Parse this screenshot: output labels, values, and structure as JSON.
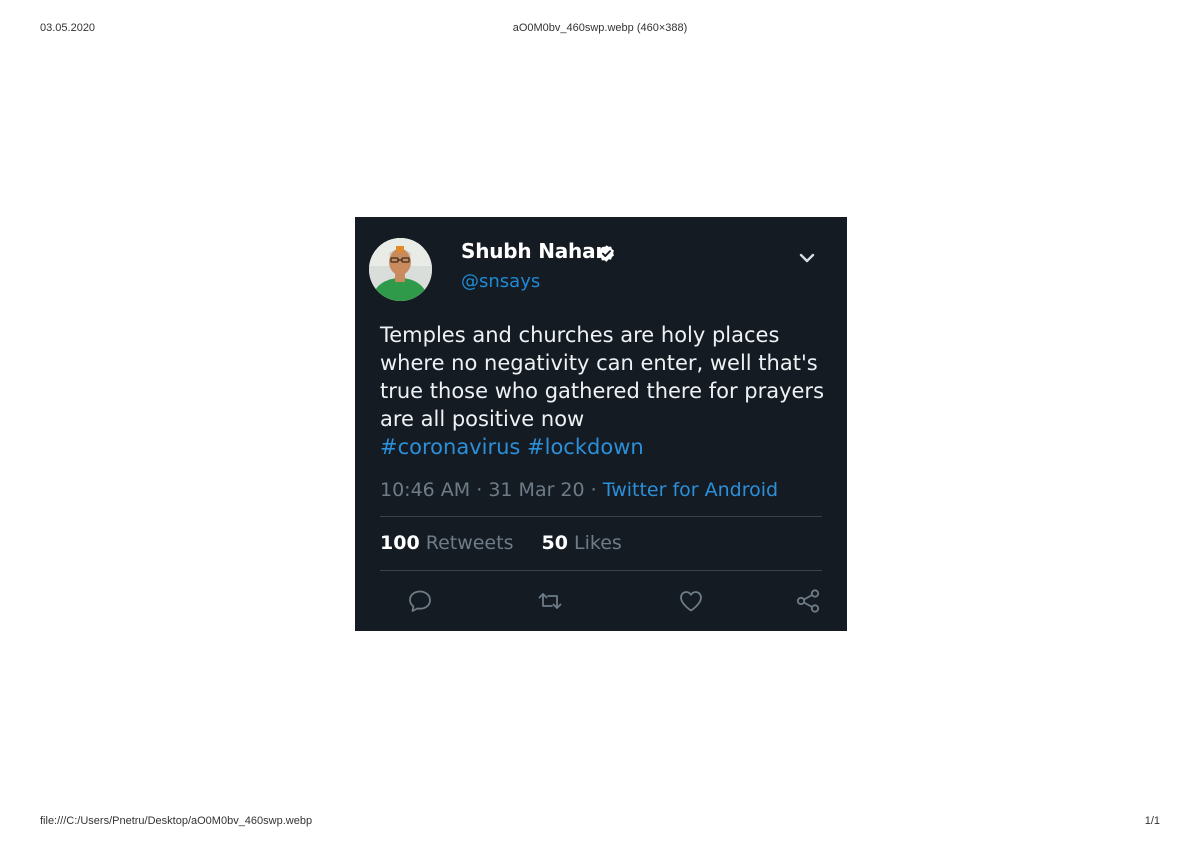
{
  "print_header": {
    "date": "03.05.2020",
    "title": "aO0M0bv_460swp.webp (460×388)"
  },
  "print_footer": {
    "path": "file:///C:/Users/Pnetru/Desktop/aO0M0bv_460swp.webp",
    "page": "1/1"
  },
  "tweet": {
    "display_name": "Shubh Nahar",
    "handle": "@snsays",
    "verified": true,
    "text_lines": [
      "Temples and churches are holy places",
      "where no negativity can enter, well that's",
      "true those who gathered there for prayers",
      "are all positive now"
    ],
    "hashtags": [
      "#coronavirus",
      "#lockdown"
    ],
    "time": "10:46 AM",
    "date": "31 Mar 20",
    "separator": "·",
    "source": "Twitter for Android",
    "retweets_count": "100",
    "retweets_label": "Retweets",
    "likes_count": "50",
    "likes_label": "Likes",
    "icons": {
      "menu": "chevron-down-icon",
      "reply": "reply-icon",
      "retweet": "retweet-icon",
      "like": "heart-icon",
      "share": "share-icon",
      "verified": "verified-badge-icon"
    },
    "colors": {
      "background": "#151b23",
      "link": "#2b8fd9",
      "muted": "#6e7c88",
      "text": "#eef2f5"
    }
  }
}
